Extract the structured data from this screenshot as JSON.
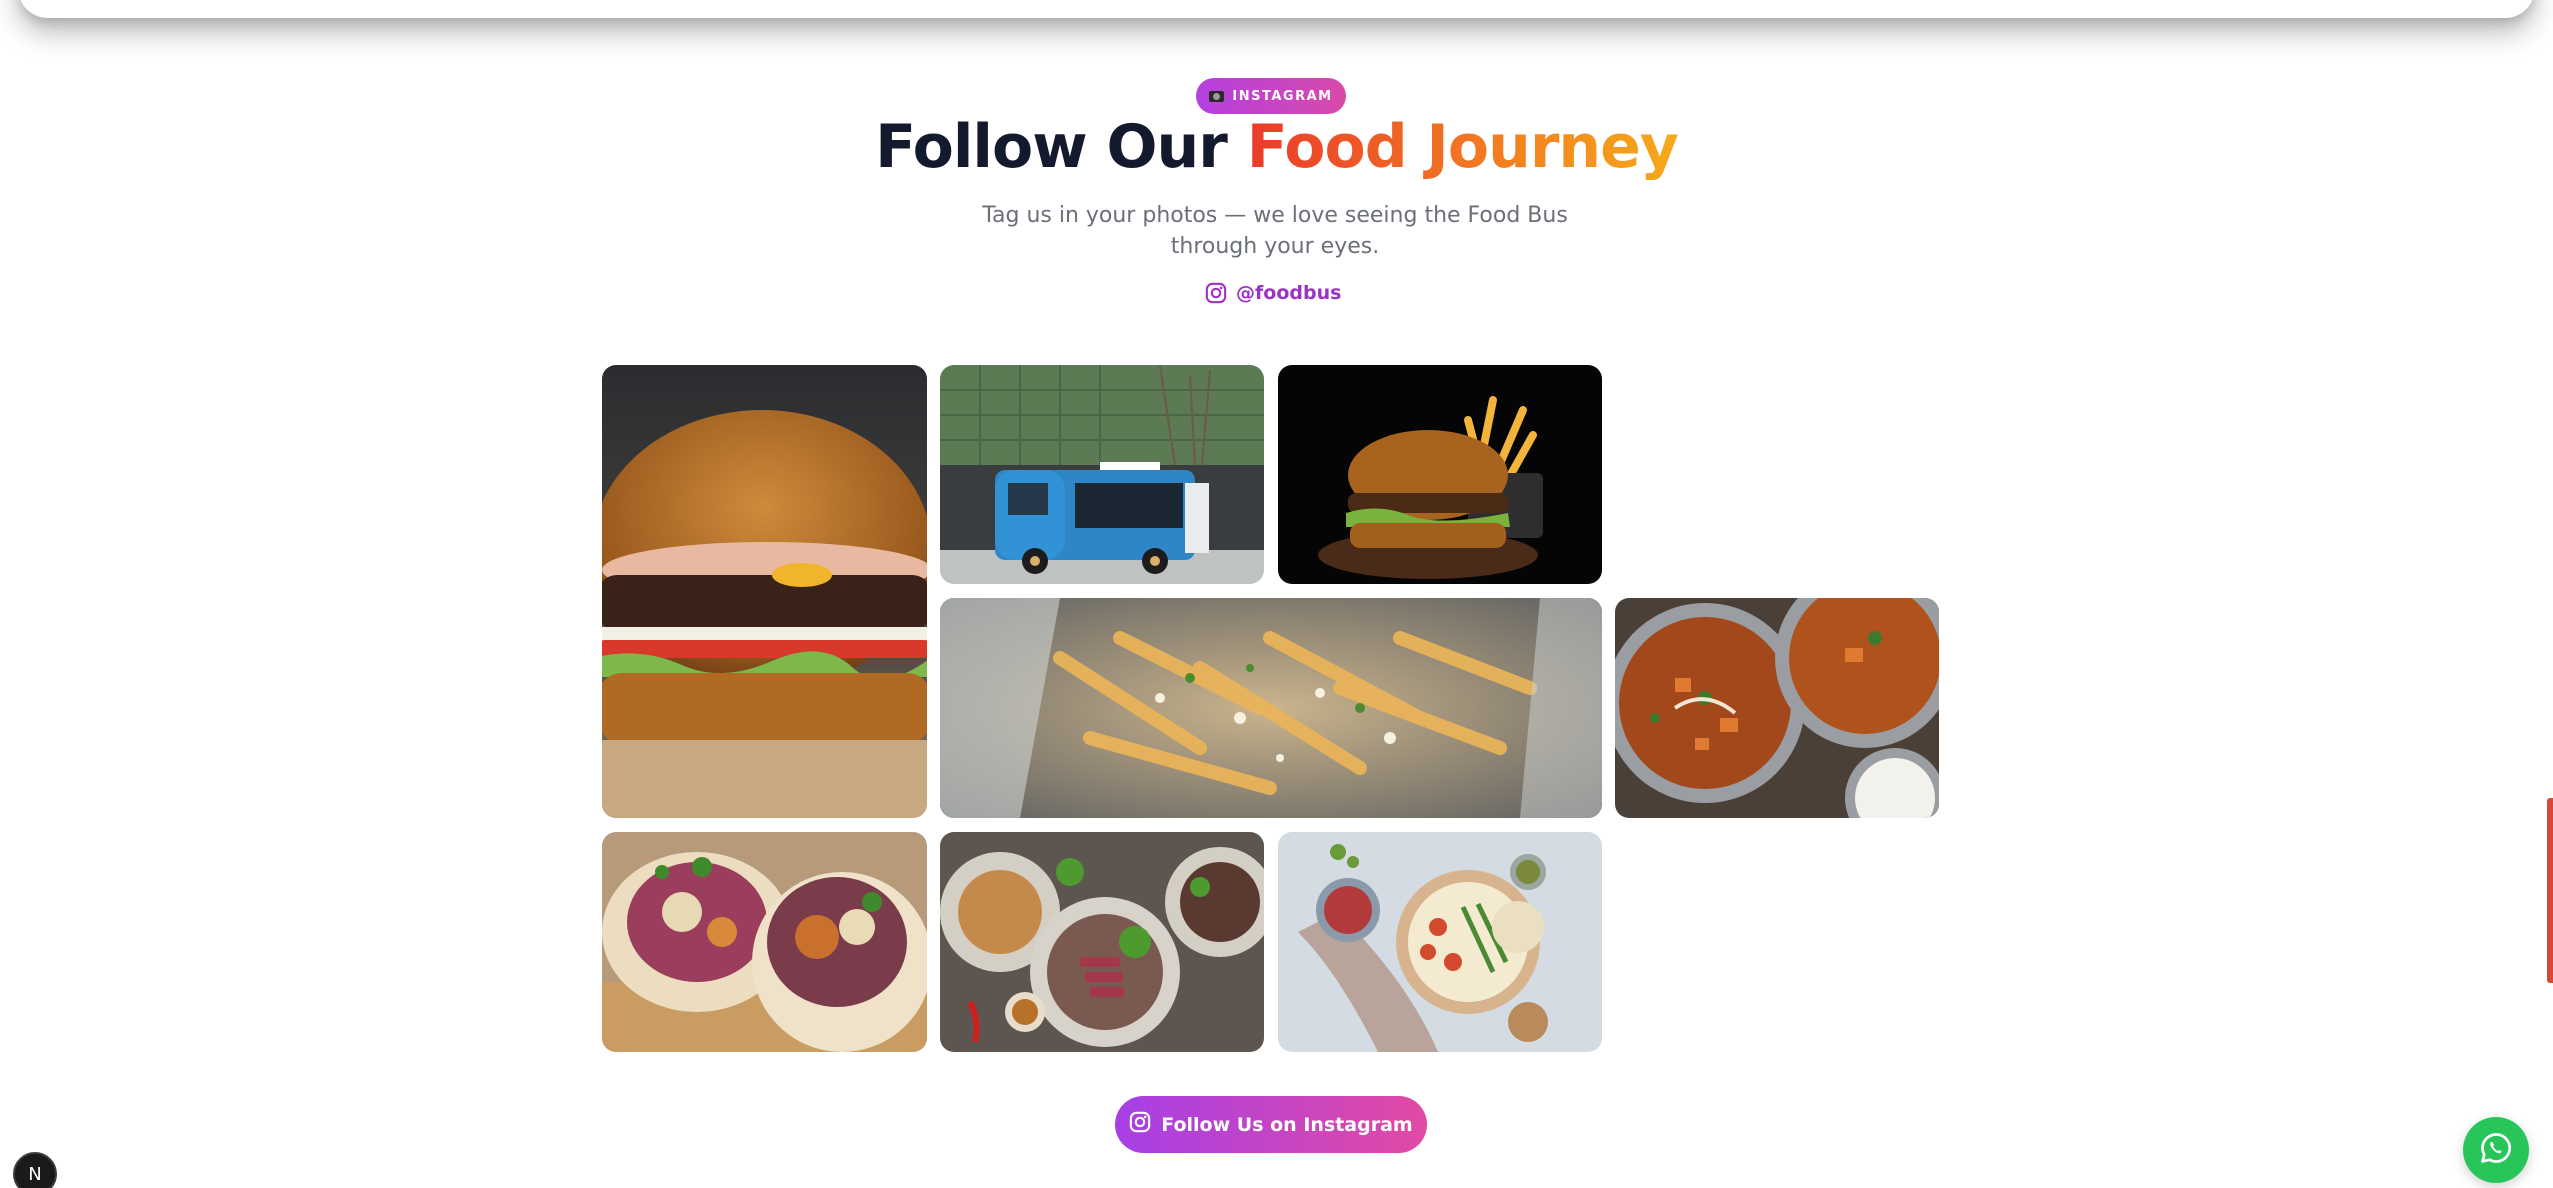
{
  "badge": {
    "label": "INSTAGRAM",
    "icon": "camera-icon"
  },
  "heading": {
    "part1": "Follow Our ",
    "accent": "Food Journey"
  },
  "subtitle": "Tag us in your photos — we love seeing the Food Bus through your eyes.",
  "handle": {
    "text": "@foodbus",
    "icon": "instagram-icon"
  },
  "gallery": {
    "tiles": [
      {
        "subject": "burger-closeup"
      },
      {
        "subject": "blue-food-truck"
      },
      {
        "subject": "burger-and-fries"
      },
      {
        "subject": "loaded-fries"
      },
      {
        "subject": "curry-bowls"
      },
      {
        "subject": "wraps"
      },
      {
        "subject": "steak-plates"
      },
      {
        "subject": "salad-bowl"
      }
    ]
  },
  "cta": {
    "label": "Follow Us on Instagram",
    "icon": "instagram-icon"
  },
  "floating": {
    "whatsapp_icon": "whatsapp-icon",
    "dev_badge": "N"
  },
  "colors": {
    "brand_purple": "#a63fe6",
    "brand_pink": "#e24aa4",
    "accent_red": "#ea3a2a",
    "accent_orange": "#f5aa1a",
    "whatsapp_green": "#28c65a"
  }
}
